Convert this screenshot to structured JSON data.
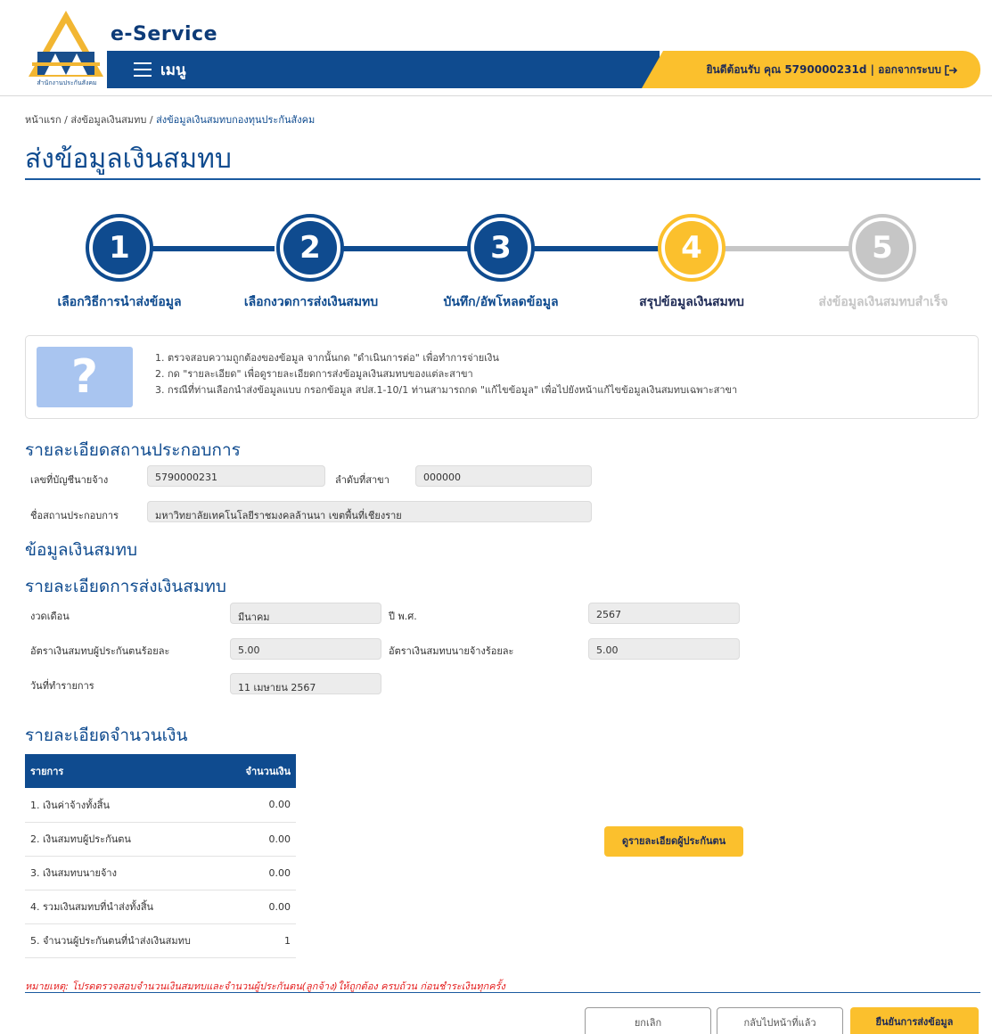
{
  "header": {
    "logo_caption": "สำนักงานประกันสังคม",
    "brand": "e-Service",
    "menu_label": "เมนู",
    "welcome": "ยินดีต้อนรับ คุณ 5790000231d | ออกจากระบบ",
    "logout_icon": "logout-icon",
    "colors": {
      "primary": "#0f4b8f",
      "accent": "#fbc02d"
    }
  },
  "breadcrumb": {
    "home": "หน้าแรก",
    "sep": " / ",
    "level2": "ส่งข้อมูลเงินสมทบ",
    "current": "ส่งข้อมูลเงินสมทบกองทุนประกันสังคม"
  },
  "page_title": "ส่งข้อมูลเงินสมทบ",
  "stepper": {
    "steps": [
      {
        "number": "1",
        "label": "เลือกวิธีการนำส่งข้อมูล",
        "state": "done"
      },
      {
        "number": "2",
        "label": "เลือกงวดการส่งเงินสมทบ",
        "state": "done"
      },
      {
        "number": "3",
        "label": "บันทึก/อัพโหลดข้อมูล",
        "state": "done"
      },
      {
        "number": "4",
        "label": "สรุปข้อมูลเงินสมทบ",
        "state": "current"
      },
      {
        "number": "5",
        "label": "ส่งข้อมูลเงินสมทบสำเร็จ",
        "state": "pending"
      }
    ]
  },
  "info": {
    "icon": "question-icon",
    "icon_text": "?",
    "lines": [
      "1. ตรวจสอบความถูกต้องของข้อมูล จากนั้นกด \"ดำเนินการต่อ\" เพื่อทำการจ่ายเงิน",
      "2. กด \"รายละเอียด\" เพื่อดูรายละเอียดการส่งข้อมูลเงินสมทบของแต่ละสาขา",
      "3. กรณีที่ท่านเลือกนำส่งข้อมูลแบบ กรอกข้อมูล สปส.1-10/1 ท่านสามารถกด \"แก้ไขข้อมูล\" เพื่อไปยังหน้าแก้ไขข้อมูลเงินสมทบเฉพาะสาขา"
    ]
  },
  "establishment": {
    "title": "รายละเอียดสถานประกอบการ",
    "account_label": "เลขที่บัญชีนายจ้าง",
    "account_value": "5790000231",
    "branch_label": "ลำดับที่สาขา",
    "branch_value": "000000",
    "name_label": "ชื่อสถานประกอบการ",
    "name_value": "มหาวิทยาลัยเทคโนโลยีราชมงคลล้านนา เขตพื้นที่เชียงราย"
  },
  "contribution_title": "ข้อมูลเงินสมทบ",
  "submission": {
    "title": "รายละเอียดการส่งเงินสมทบ",
    "period_label": "งวดเดือน",
    "period_value": "มีนาคม",
    "year_label": "ปี พ.ศ.",
    "year_value": "2567",
    "insured_rate_label": "อัตราเงินสมทบผู้ประกันตนร้อยละ",
    "insured_rate_value": "5.00",
    "employer_rate_label": "อัตราเงินสมทบนายจ้างร้อยละ",
    "employer_rate_value": "5.00",
    "date_label": "วันที่ทำรายการ",
    "date_value": "11 เมษายน 2567"
  },
  "amounts": {
    "title": "รายละเอียดจำนวนเงิน",
    "col_item": "รายการ",
    "col_amount": "จำนวนเงิน",
    "rows": [
      {
        "item": "1. เงินค่าจ้างทั้งสิ้น",
        "amount": "0.00"
      },
      {
        "item": "2. เงินสมทบผู้ประกันตน",
        "amount": "0.00"
      },
      {
        "item": "3. เงินสมทบนายจ้าง",
        "amount": "0.00"
      },
      {
        "item": "4. รวมเงินสมทบที่นำส่งทั้งสิ้น",
        "amount": "0.00"
      },
      {
        "item": "5. จำนวนผู้ประกันตนที่นำส่งเงินสมทบ",
        "amount": "1"
      }
    ],
    "view_insured_button": "ดูรายละเอียดผู้ประกันตน"
  },
  "remark": "หมายเหตุ: โปรดตรวจสอบจำนวนเงินสมทบและจำนวนผู้ประกันตน(ลูกจ้าง)ให้ถูกต้อง ครบถ้วน ก่อนชำระเงินทุกครั้ง",
  "actions": {
    "cancel": "ยกเลิก",
    "back": "กลับไปหน้าที่แล้ว",
    "confirm": "ยืนยันการส่งข้อมูล"
  }
}
